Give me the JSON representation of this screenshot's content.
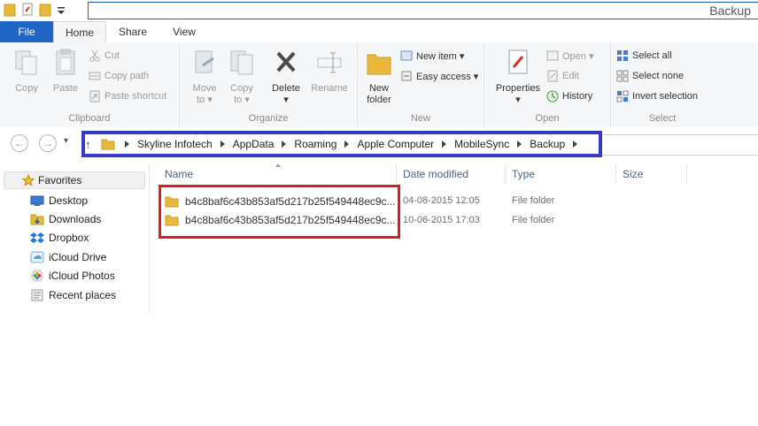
{
  "window": {
    "title": "Backup"
  },
  "tabs": {
    "file": "File",
    "home": "Home",
    "share": "Share",
    "view": "View"
  },
  "ribbon": {
    "clipboard": {
      "label": "Clipboard",
      "copy": "Copy",
      "paste": "Paste",
      "cut": "Cut",
      "copy_path": "Copy path",
      "paste_shortcut": "Paste shortcut"
    },
    "organize": {
      "label": "Organize",
      "move_to": "Move",
      "move_to2": "to ▾",
      "copy_to": "Copy",
      "copy_to2": "to ▾",
      "delete": "Delete",
      "delete2": "▾",
      "rename": "Rename"
    },
    "new": {
      "label": "New",
      "new_folder": "New",
      "new_folder2": "folder",
      "new_item": "New item ▾",
      "easy_access": "Easy access ▾"
    },
    "open": {
      "label": "Open",
      "properties": "Properties",
      "properties2": "▾",
      "open": "Open ▾",
      "edit": "Edit",
      "history": "History"
    },
    "select": {
      "label": "Select",
      "select_all": "Select all",
      "select_none": "Select none",
      "invert_selection": "Invert selection"
    }
  },
  "nav": {
    "back": "←",
    "forward": "→",
    "recent": "▾",
    "up": "↑"
  },
  "breadcrumb": [
    "Skyline Infotech",
    "AppData",
    "Roaming",
    "Apple Computer",
    "MobileSync",
    "Backup"
  ],
  "navpane": {
    "favorites": "Favorites",
    "items": [
      "Desktop",
      "Downloads",
      "Dropbox",
      "iCloud Drive",
      "iCloud Photos",
      "Recent places"
    ]
  },
  "columns": {
    "name": "Name",
    "date": "Date modified",
    "type": "Type",
    "size": "Size"
  },
  "files": [
    {
      "name": "b4c8baf6c43b853af5d217b25f549448ec9c...",
      "date": "04-08-2015 12:05",
      "type": "File folder"
    },
    {
      "name": "b4c8baf6c43b853af5d217b25f549448ec9c...",
      "date": "10-06-2015 17:03",
      "type": "File folder"
    }
  ],
  "colors": {
    "accent": "#1f65c4",
    "highlight_blue": "#3a3ac8",
    "highlight_red": "#e01b1b",
    "folder": "#e8b93a"
  }
}
